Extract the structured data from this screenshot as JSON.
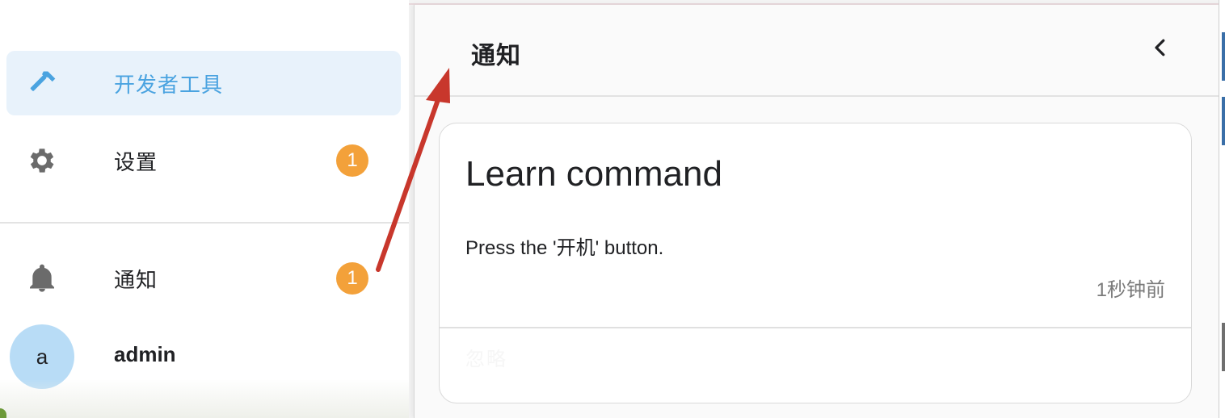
{
  "sidebar": {
    "items": [
      {
        "label": "开发者工具",
        "icon": "hammer-icon",
        "active": true
      },
      {
        "label": "设置",
        "icon": "gear-icon",
        "badge": "1"
      },
      {
        "label": "通知",
        "icon": "bell-icon",
        "badge": "1"
      }
    ],
    "user": {
      "avatar_letter": "a",
      "name": "admin"
    }
  },
  "drawer": {
    "title": "通知",
    "back_icon": "chevron-left-icon",
    "notification": {
      "title": "Learn command",
      "message": "Press the '开机' button.",
      "time": "1秒钟前",
      "dismiss_label": "忽略"
    }
  },
  "colors": {
    "accent": "#4aa3e0",
    "active_bg": "#e8f2fb",
    "badge": "#f3a13a",
    "avatar": "#b8dcf6",
    "annotation_arrow": "#c8372c"
  }
}
